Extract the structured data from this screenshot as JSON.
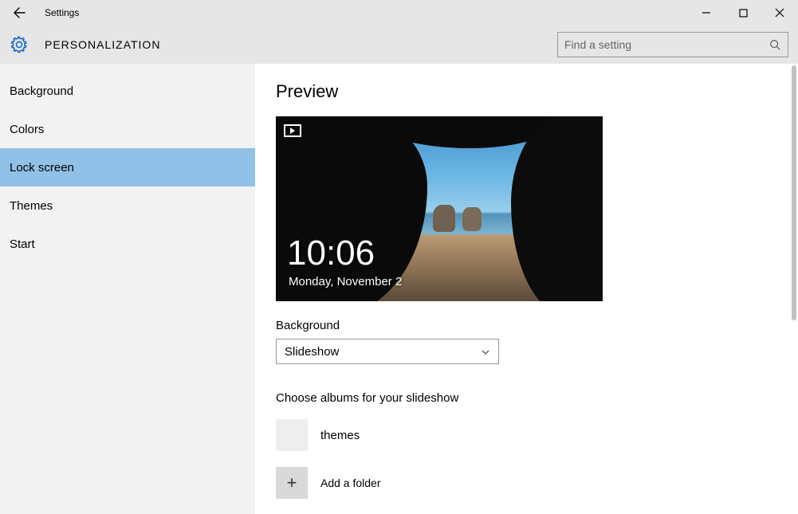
{
  "window": {
    "title": "Settings"
  },
  "header": {
    "section_title": "PERSONALIZATION",
    "search_placeholder": "Find a setting"
  },
  "sidebar": {
    "items": [
      {
        "label": "Background",
        "selected": false
      },
      {
        "label": "Colors",
        "selected": false
      },
      {
        "label": "Lock screen",
        "selected": true
      },
      {
        "label": "Themes",
        "selected": false
      },
      {
        "label": "Start",
        "selected": false
      }
    ]
  },
  "content": {
    "preview_heading": "Preview",
    "lock_time": "10:06",
    "lock_date": "Monday, November 2",
    "background_label": "Background",
    "background_value": "Slideshow",
    "albums_label": "Choose albums for your slideshow",
    "albums": [
      {
        "name": "themes"
      }
    ],
    "add_folder_label": "Add a folder"
  }
}
